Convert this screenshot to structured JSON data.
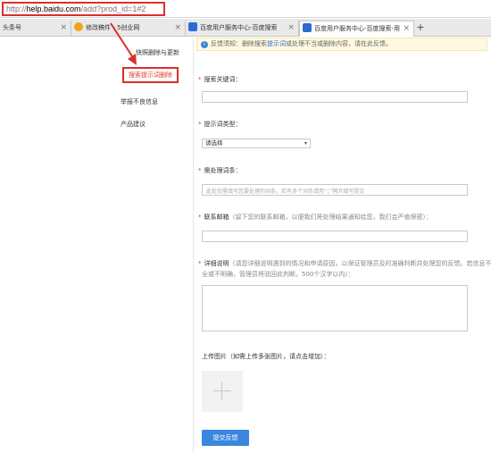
{
  "browser": {
    "url_proto": "http://",
    "url_host": "help.baidu.com",
    "url_path": "/add?prod_id=1#2",
    "tabs": [
      {
        "label": "头条号",
        "active": false
      },
      {
        "label": "修改稿件 - 5创业网",
        "active": false
      },
      {
        "label": "百度用户服务中心-百度搜索",
        "active": false
      },
      {
        "label": "百度用户服务中心-百度搜索-用",
        "active": true
      }
    ],
    "close_glyph": "×",
    "newtab_glyph": "+"
  },
  "sidebar": {
    "items": [
      {
        "label": "快照删除与更新"
      },
      {
        "label": "搜索提示词删除",
        "active": true
      },
      {
        "label": "举报不良信息"
      },
      {
        "label": "产品建议"
      }
    ]
  },
  "notice": {
    "icon": "i",
    "text_before": "反馈须知：删除搜索",
    "link": "提示词",
    "text_after": "或处理不当或删除内容，请在此反馈。"
  },
  "form": {
    "keyword_label": "搜索关键词：",
    "type_label": "提示词类型：",
    "type_selected": "请选择",
    "word_label": "需处理词条：",
    "word_placeholder": "此处仅需填写您要处理的词条，若有多个词条请用“；”隔开填写提交",
    "email_label": "联系邮箱",
    "email_hint": "（留下您的联系邮箱，以便我们将处理结果通知给您，我们会严格保密）：",
    "detail_label": "详细说明",
    "detail_hint_1": "（请您详细说明遇到的情况和申请原因，以保证管理员及时准确判断并处理您的反馈。若信息不",
    "detail_hint_2": "全或不明确，管理员将驳回此判断。500个汉字以内）：",
    "upload_label": "上传图片（如需上传多张图片，请点击增加）：",
    "required_mark": "*",
    "submit_label": "提交反馈"
  }
}
